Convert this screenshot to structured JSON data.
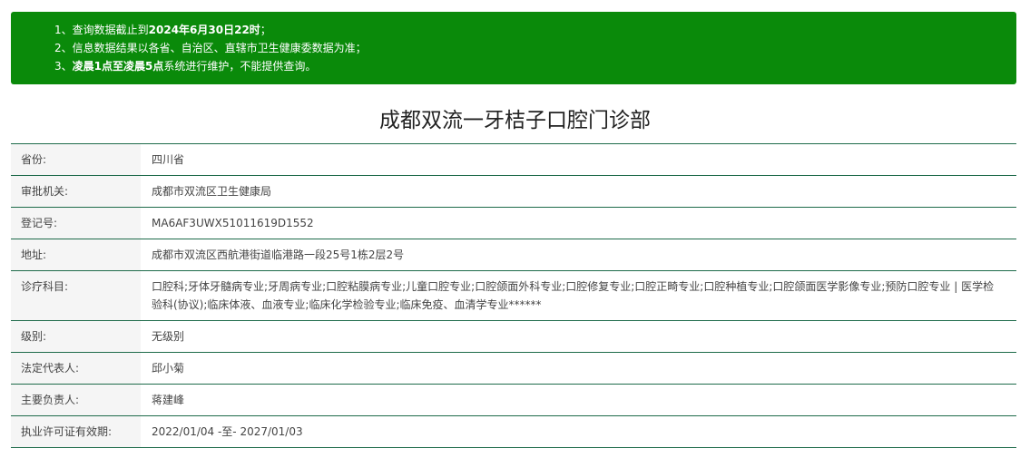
{
  "notice": {
    "line1_prefix": "1、查询数据截止到",
    "line1_bold": "2024年6月30日22时",
    "line1_suffix": "；",
    "line2": "2、信息数据结果以各省、自治区、直辖市卫生健康委数据为准；",
    "line3_prefix": "3、",
    "line3_bold1": "凌晨1点至凌晨5点",
    "line3_suffix": "系统进行维护，不能提供查询。"
  },
  "title": "成都双流一牙桔子口腔门诊部",
  "rows": [
    {
      "label": "省份:",
      "value": "四川省"
    },
    {
      "label": "审批机关:",
      "value": "成都市双流区卫生健康局"
    },
    {
      "label": "登记号:",
      "value": "MA6AF3UWX51011619D1552"
    },
    {
      "label": "地址:",
      "value": "成都市双流区西航港街道临港路一段25号1栋2层2号"
    },
    {
      "label": "诊疗科目:",
      "value": "口腔科;牙体牙髓病专业;牙周病专业;口腔粘膜病专业;儿童口腔专业;口腔颌面外科专业;口腔修复专业;口腔正畸专业;口腔种植专业;口腔颌面医学影像专业;预防口腔专业 | 医学检验科(协议);临床体液、血液专业;临床化学检验专业;临床免疫、血清学专业******"
    },
    {
      "label": "级别:",
      "value": "无级别"
    },
    {
      "label": "法定代表人:",
      "value": "邱小菊"
    },
    {
      "label": "主要负责人:",
      "value": "蒋建峰"
    },
    {
      "label": "执业许可证有效期:",
      "value": "2022/01/04 -至- 2027/01/03"
    }
  ]
}
